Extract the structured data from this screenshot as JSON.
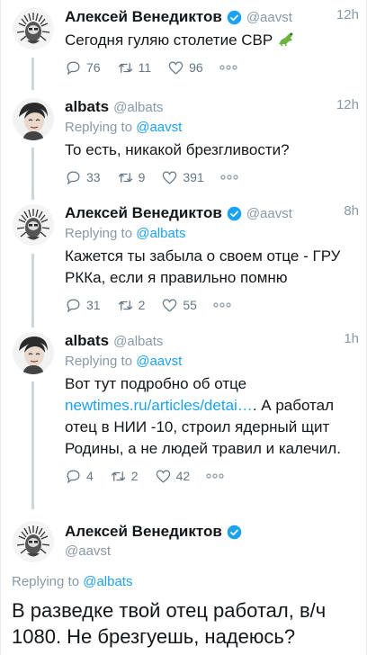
{
  "tweets": [
    {
      "name": "Алексей Венедиктов",
      "handle": "@aavst",
      "time": "12h",
      "verified": true,
      "text": "Сегодня гуляю столетие СВР",
      "replies": "76",
      "retweets": "11",
      "likes": "96",
      "avatar": "venediktov-avatar"
    },
    {
      "name": "albats",
      "handle": "@albats",
      "time": "12h",
      "reply_label": "Replying to",
      "reply_handle": "@aavst",
      "text": "То есть, никакой брезгливости?",
      "replies": "33",
      "retweets": "9",
      "likes": "391",
      "avatar": "albats-avatar"
    },
    {
      "name": "Алексей Венедиктов",
      "handle": "@aavst",
      "time": "8h",
      "verified": true,
      "reply_label": "Replying to",
      "reply_handle": "@albats",
      "text": "Кажется ты забыла о своем отце - ГРУ РККа, если я правильно помню",
      "replies": "31",
      "retweets": "2",
      "likes": "55",
      "avatar": "venediktov-avatar"
    },
    {
      "name": "albats",
      "handle": "@albats",
      "time": "1h",
      "reply_label": "Replying to",
      "reply_handle": "@aavst",
      "text_before": "Вот тут подробно об отце ",
      "text_link": "newtimes.ru/articles/detai…",
      "text_after": ". А работал отец в НИИ -10, строил ядерный щит Родины, а не людей травил и калечил.",
      "replies": "4",
      "retweets": "2",
      "likes": "42",
      "avatar": "albats-avatar"
    }
  ],
  "main": {
    "name": "Алексей Венедиктов",
    "handle": "@aavst",
    "verified": true,
    "reply_label": "Replying to",
    "reply_handle": "@albats",
    "text": "В разведке твой отец работал, в/ч 1080. Не брезгуешь, надеюсь?",
    "avatar": "venediktov-avatar"
  },
  "colors": {
    "accent": "#1da1f2",
    "muted": "#8899a6",
    "thread_line": "#ccd6dd"
  }
}
